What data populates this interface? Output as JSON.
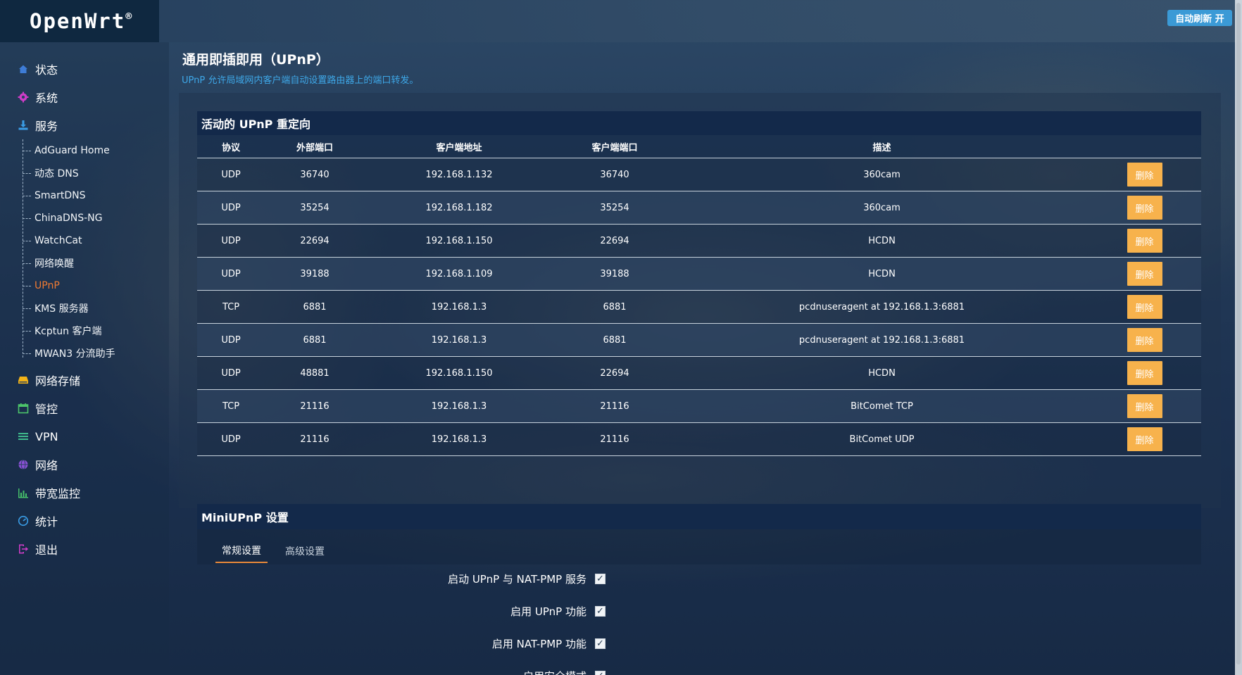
{
  "brand": {
    "name": "OpenWrt",
    "reg": "®"
  },
  "topbar": {
    "refresh_label": "自动刷新 开"
  },
  "sidebar": {
    "items": [
      {
        "label": "状态",
        "icon": "home-icon"
      },
      {
        "label": "系统",
        "icon": "gear-icon"
      },
      {
        "label": "服务",
        "icon": "download-icon"
      }
    ],
    "service_items": [
      "AdGuard Home",
      "动态 DNS",
      "SmartDNS",
      "ChinaDNS-NG",
      "WatchCat",
      "网络唤醒",
      "UPnP",
      "KMS 服务器",
      "Kcptun 客户端",
      "MWAN3 分流助手"
    ],
    "active_service": "UPnP",
    "lower_items": [
      {
        "label": "网络存储",
        "icon": "storage-icon"
      },
      {
        "label": "管控",
        "icon": "calendar-icon"
      },
      {
        "label": "VPN",
        "icon": "menu-lines-icon"
      },
      {
        "label": "网络",
        "icon": "globe-icon"
      },
      {
        "label": "带宽监控",
        "icon": "bar-chart-icon"
      },
      {
        "label": "统计",
        "icon": "dashboard-icon"
      },
      {
        "label": "退出",
        "icon": "logout-icon"
      }
    ]
  },
  "page": {
    "title": "通用即插即用（UPnP）",
    "description": "UPnP 允许局域网内客户端自动设置路由器上的端口转发。"
  },
  "redirects": {
    "title": "活动的 UPnP 重定向",
    "columns": [
      "协议",
      "外部端口",
      "客户端地址",
      "客户端端口",
      "描述"
    ],
    "delete_label": "删除",
    "rows": [
      {
        "proto": "UDP",
        "ext": "36740",
        "addr": "192.168.1.132",
        "cport": "36740",
        "desc": "360cam"
      },
      {
        "proto": "UDP",
        "ext": "35254",
        "addr": "192.168.1.182",
        "cport": "35254",
        "desc": "360cam"
      },
      {
        "proto": "UDP",
        "ext": "22694",
        "addr": "192.168.1.150",
        "cport": "22694",
        "desc": "HCDN"
      },
      {
        "proto": "UDP",
        "ext": "39188",
        "addr": "192.168.1.109",
        "cport": "39188",
        "desc": "HCDN"
      },
      {
        "proto": "TCP",
        "ext": "6881",
        "addr": "192.168.1.3",
        "cport": "6881",
        "desc": "pcdnuseragent at 192.168.1.3:6881"
      },
      {
        "proto": "UDP",
        "ext": "6881",
        "addr": "192.168.1.3",
        "cport": "6881",
        "desc": "pcdnuseragent at 192.168.1.3:6881"
      },
      {
        "proto": "UDP",
        "ext": "48881",
        "addr": "192.168.1.150",
        "cport": "22694",
        "desc": "HCDN"
      },
      {
        "proto": "TCP",
        "ext": "21116",
        "addr": "192.168.1.3",
        "cport": "21116",
        "desc": "BitComet TCP"
      },
      {
        "proto": "UDP",
        "ext": "21116",
        "addr": "192.168.1.3",
        "cport": "21116",
        "desc": "BitComet UDP"
      }
    ]
  },
  "settings": {
    "title": "MiniUPnP 设置",
    "tabs": [
      "常规设置",
      "高级设置"
    ],
    "active_tab": "常规设置",
    "options": [
      {
        "label": "启动 UPnP 与 NAT-PMP 服务",
        "checked": true
      },
      {
        "label": "启用 UPnP 功能",
        "checked": true
      },
      {
        "label": "启用 NAT-PMP 功能",
        "checked": true
      },
      {
        "label": "启用安全模式",
        "checked": true
      }
    ]
  }
}
